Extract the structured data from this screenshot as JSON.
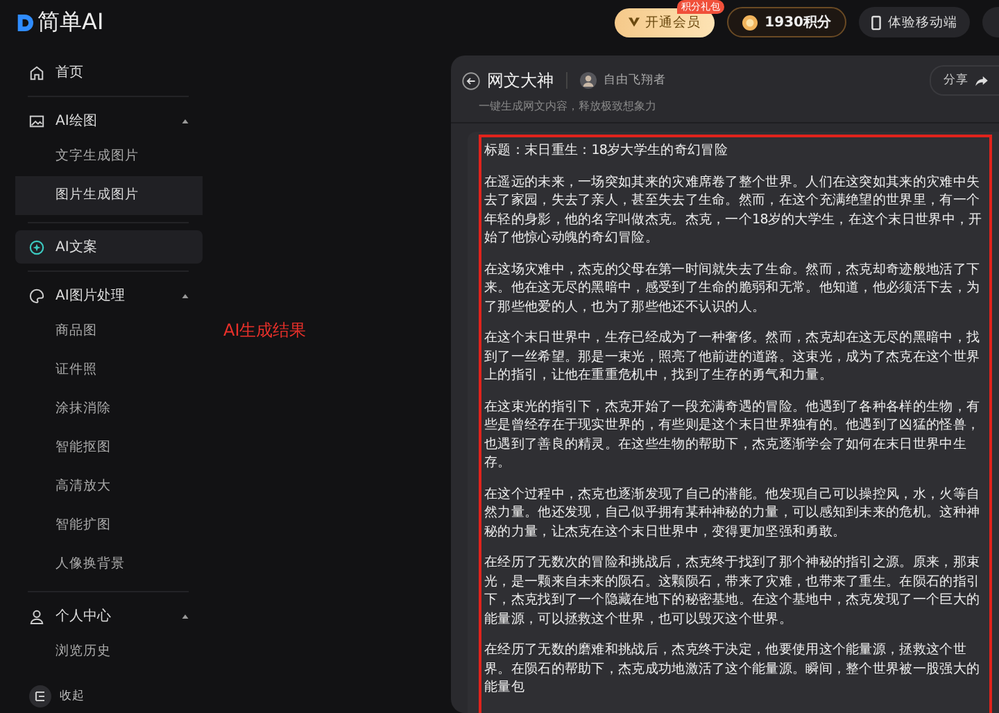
{
  "logo": {
    "text": "简单AI"
  },
  "header": {
    "vip_button": {
      "label": "开通会员",
      "badge": "积分礼包"
    },
    "points_button": {
      "label": "1930积分"
    },
    "mobile_button": {
      "label": "体验移动端"
    }
  },
  "sidebar": {
    "items": [
      {
        "kind": "home",
        "label": "首页",
        "selected": false
      },
      {
        "kind": "image",
        "label": "AI绘图",
        "selected": false,
        "expanded": true,
        "children": [
          {
            "label": "文字生成图片",
            "selected": false
          },
          {
            "label": "图片生成图片",
            "selected": true
          }
        ]
      },
      {
        "kind": "ai",
        "label": "AI文案",
        "selected": true
      },
      {
        "kind": "palette",
        "label": "AI图片处理",
        "selected": false,
        "expanded": true,
        "children": [
          {
            "label": "商品图",
            "selected": false
          },
          {
            "label": "证件照",
            "selected": false
          },
          {
            "label": "涂抹消除",
            "selected": false
          },
          {
            "label": "智能抠图",
            "selected": false
          },
          {
            "label": "高清放大",
            "selected": false
          },
          {
            "label": "智能扩图",
            "selected": false
          },
          {
            "label": "人像换背景",
            "selected": false
          }
        ]
      },
      {
        "kind": "user",
        "label": "个人中心",
        "selected": false,
        "expanded": true,
        "children": [
          {
            "label": "浏览历史",
            "selected": false
          }
        ]
      }
    ],
    "collapse_label": "收起"
  },
  "annotation": {
    "label": "AI生成结果"
  },
  "panel": {
    "title": "网文大神",
    "author": "自由飞翔者",
    "subtitle": "一键生成网文内容，释放极致想象力",
    "share_label": "分享",
    "paragraphs": [
      "标题：末日重生：18岁大学生的奇幻冒险",
      "在遥远的未来，一场突如其来的灾难席卷了整个世界。人们在这突如其来的灾难中失去了家园，失去了亲人，甚至失去了生命。然而，在这个充满绝望的世界里，有一个年轻的身影，他的名字叫做杰克。杰克，一个18岁的大学生，在这个末日世界中，开始了他惊心动魄的奇幻冒险。",
      "在这场灾难中，杰克的父母在第一时间就失去了生命。然而，杰克却奇迹般地活了下来。他在这无尽的黑暗中，感受到了生命的脆弱和无常。他知道，他必须活下去，为了那些他爱的人，也为了那些他还不认识的人。",
      "在这个末日世界中，生存已经成为了一种奢侈。然而，杰克却在这无尽的黑暗中，找到了一丝希望。那是一束光，照亮了他前进的道路。这束光，成为了杰克在这个世界上的指引，让他在重重危机中，找到了生存的勇气和力量。",
      "在这束光的指引下，杰克开始了一段充满奇遇的冒险。他遇到了各种各样的生物，有些是曾经存在于现实世界的，有些则是这个末日世界独有的。他遇到了凶猛的怪兽，也遇到了善良的精灵。在这些生物的帮助下，杰克逐渐学会了如何在末日世界中生存。",
      "在这个过程中，杰克也逐渐发现了自己的潜能。他发现自己可以操控风，水，火等自然力量。他还发现，自己似乎拥有某种神秘的力量，可以感知到未来的危机。这种神秘的力量，让杰克在这个末日世界中，变得更加坚强和勇敢。",
      "在经历了无数次的冒险和挑战后，杰克终于找到了那个神秘的指引之源。原来，那束光，是一颗来自未来的陨石。这颗陨石，带来了灾难，也带来了重生。在陨石的指引下，杰克找到了一个隐藏在地下的秘密基地。在这个基地中，杰克发现了一个巨大的能量源，可以拯救这个世界，也可以毁灭这个世界。",
      "在经历了无数的磨难和挑战后，杰克终于决定，他要使用这个能量源，拯救这个世界。在陨石的帮助下，杰克成功地激活了这个能量源。瞬间，整个世界被一股强大的能量包"
    ]
  }
}
